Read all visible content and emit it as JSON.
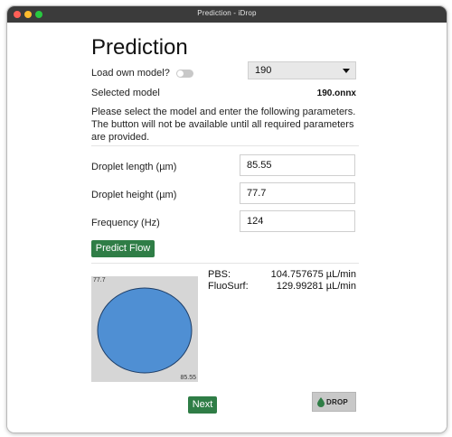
{
  "window": {
    "title": "Prediction - iDrop"
  },
  "page": {
    "heading": "Prediction",
    "load_own_model_label": "Load own model?",
    "model_select_value": "190",
    "selected_model_label": "Selected model",
    "selected_model_value": "190.onnx",
    "instructions": "Please select the model and enter the following parameters. The button will not be available until all required parameters are provided."
  },
  "params": {
    "droplet_length_label": "Droplet length (µm)",
    "droplet_length_value": "85.55",
    "droplet_height_label": "Droplet height (µm)",
    "droplet_height_value": "77.7",
    "frequency_label": "Frequency (Hz)",
    "frequency_value": "124"
  },
  "actions": {
    "predict_label": "Predict Flow",
    "next_label": "Next"
  },
  "preview": {
    "height_label": "77.7",
    "length_label": "85.55",
    "droplet_color": "#4f8fd3"
  },
  "results": [
    {
      "name": "PBS:",
      "value": "104.757675 µL/min"
    },
    {
      "name": "FluoSurf:",
      "value": "129.99281 µL/min"
    }
  ],
  "logo": {
    "text": "DROP"
  },
  "colors": {
    "accent_green": "#2f7d46",
    "titlebar": "#3b3b3b"
  }
}
